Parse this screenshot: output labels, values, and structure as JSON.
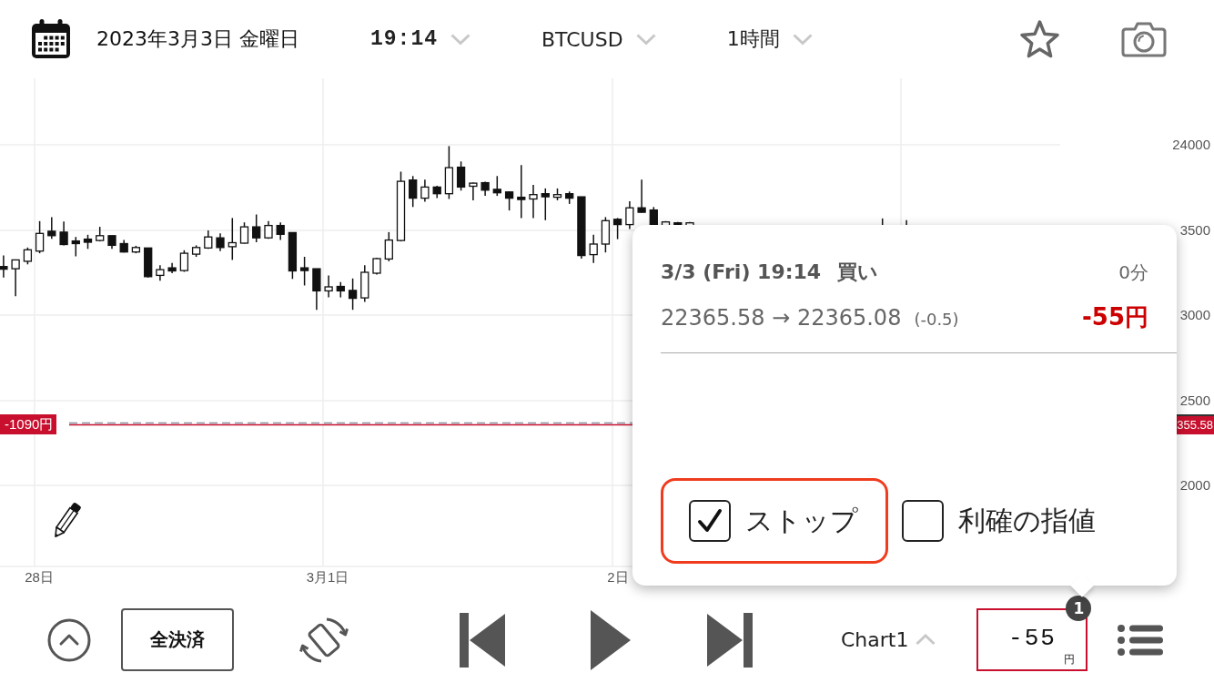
{
  "header": {
    "date": "2023年3月3日 金曜日",
    "dropdowns": [
      {
        "kind": "time",
        "value": "19:14"
      },
      {
        "kind": "symbol",
        "value": "BTCUSD"
      },
      {
        "kind": "interval",
        "value": "1時間"
      }
    ]
  },
  "chart": {
    "y_axis_labels": [
      "24000",
      "3500",
      "3000",
      "2500",
      "2000"
    ],
    "x_axis_labels": [
      "28日",
      "3月1日",
      "2日"
    ],
    "position_line": {
      "profit_tag": "-1090円",
      "price_tag": "355.58"
    }
  },
  "trade_popup": {
    "time": "3/3 (Fri) 19:14",
    "side": "買い",
    "elapsed": "0分",
    "prices": "22365.58 → 22365.08",
    "change": "(-0.5)",
    "profit": "-55円",
    "options": [
      {
        "label": "ストップ",
        "checked": true,
        "selected": true
      },
      {
        "label": "利確の指値",
        "checked": false,
        "selected": false
      }
    ]
  },
  "bottom_bar": {
    "close_all": "全決済",
    "chart_selector": "Chart1",
    "profit": {
      "value": "-55",
      "unit": "円",
      "badge": "1"
    }
  }
}
